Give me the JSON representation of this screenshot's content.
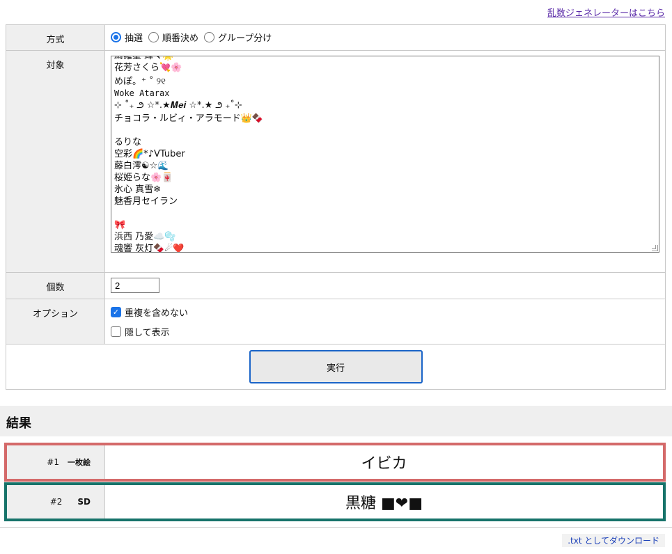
{
  "header": {
    "random_generator_link": "乱数ジェネレーターはこちら"
  },
  "form": {
    "method": {
      "label": "方式",
      "options": [
        {
          "label": "抽選",
          "checked": true
        },
        {
          "label": "順番決め",
          "checked": false
        },
        {
          "label": "グループ分け",
          "checked": false
        }
      ]
    },
    "target": {
      "label": "対象",
      "lines": [
        "綺羅星 輝々🌟",
        "花芳さくら💘🌸",
        "めぽ。⁺ ˚ ୨୧",
        "Woke Atarax",
        "⊹ ˚₊ ౨ ☆*.★𝑴𝒆𝒊 ☆*.★ ౨ ₊˚⊹",
        "チョコラ・ルビィ・アラモード👑🍫",
        "",
        "るりな",
        "空彩🌈*♪VTuber",
        "藤白澪☯☆🌊",
        "桜姫らな🌸🀄",
        "氷心 真雪❄",
        "魅香月セイラン",
        "",
        "🎀",
        "浜西 乃愛☁️🫧",
        "魂響 灰灯🍫☄❤️"
      ]
    },
    "count": {
      "label": "個数",
      "value": "2"
    },
    "options": {
      "label": "オプション",
      "items": [
        {
          "label": "重複を含めない",
          "checked": true
        },
        {
          "label": "隠して表示",
          "checked": false
        }
      ]
    },
    "run_button": "実行"
  },
  "results": {
    "title": "結果",
    "rows": [
      {
        "num": "#1",
        "tag": "一枚絵",
        "value": "イビカ",
        "color": "#d46a6a"
      },
      {
        "num": "#2",
        "tag": "SD",
        "value": "黒糖 ■❤■",
        "color": "#17736a"
      }
    ]
  },
  "footer": {
    "download_label": ".txt としてダウンロード"
  }
}
